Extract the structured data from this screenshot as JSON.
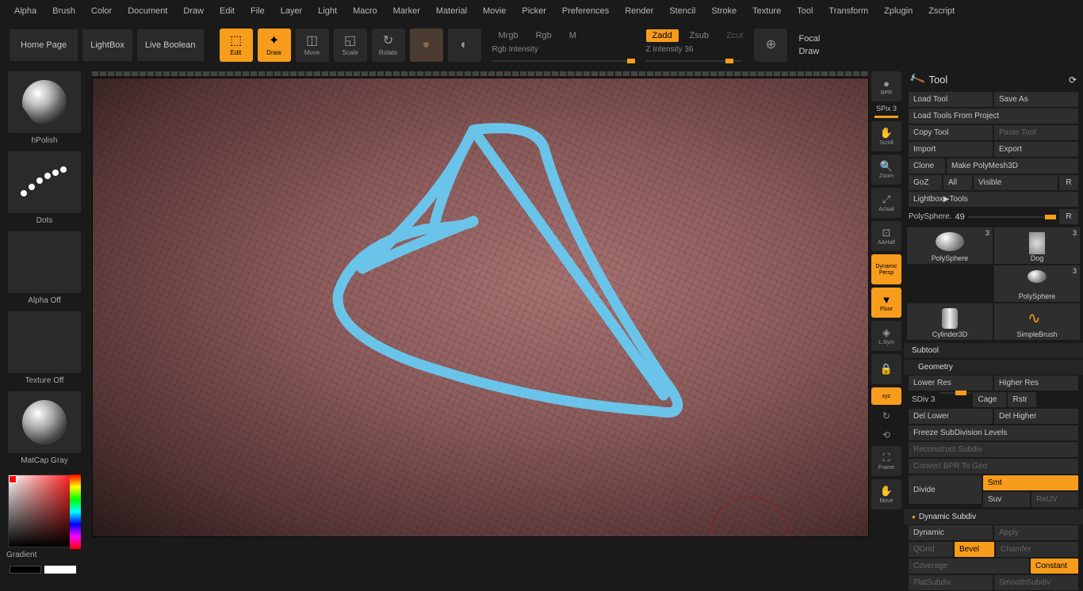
{
  "menu": [
    "Alpha",
    "Brush",
    "Color",
    "Document",
    "Draw",
    "Edit",
    "File",
    "Layer",
    "Light",
    "Macro",
    "Marker",
    "Material",
    "Movie",
    "Picker",
    "Preferences",
    "Render",
    "Stencil",
    "Stroke",
    "Texture",
    "Tool",
    "Transform",
    "Zplugin",
    "Zscript"
  ],
  "toolbar": {
    "home": "Home Page",
    "lightbox": "LightBox",
    "liveBoolean": "Live Boolean",
    "edit": "Edit",
    "draw": "Draw",
    "move": "Move",
    "scale": "Scale",
    "rotate": "Rotate",
    "mrgb": "Mrgb",
    "rgb": "Rgb",
    "m": "M",
    "rgbIntensity": "Rgb Intensity",
    "zadd": "Zadd",
    "zsub": "Zsub",
    "zcut": "Zcut",
    "zIntensity": "Z Intensity",
    "zIntensityVal": "36",
    "focal": "Focal",
    "drawSize": "Draw"
  },
  "leftPanel": {
    "brush": "hPolish",
    "stroke": "Dots",
    "alpha": "Alpha Off",
    "texture": "Texture Off",
    "material": "MatCap Gray",
    "gradient": "Gradient"
  },
  "rightTools": {
    "bpr": "BPR",
    "spix": "SPix",
    "spixVal": "3",
    "scroll": "Scroll",
    "zoom": "Zoom",
    "actual": "Actual",
    "aahalf": "AAHalf",
    "persp": "Persp",
    "floor": "Floor",
    "lsym": "L.Sym",
    "xyz": "xyz",
    "frame": "Frame",
    "moveNav": "Move"
  },
  "toolPanel": {
    "title": "Tool",
    "loadTool": "Load Tool",
    "saveAs": "Save As",
    "loadProject": "Load Tools From Project",
    "copyTool": "Copy Tool",
    "pasteTool": "Paste Tool",
    "import": "Import",
    "export": "Export",
    "clone": "Clone",
    "makePoly": "Make PolyMesh3D",
    "goz": "GoZ",
    "all": "All",
    "visible": "Visible",
    "r": "R",
    "lightboxTools": "Lightbox▶Tools",
    "polysphere": "PolySphere.",
    "polysphereVal": "49",
    "subtools": [
      {
        "name": "PolySphere",
        "count": "3"
      },
      {
        "name": "Dog",
        "count": "3"
      },
      {
        "name": "PolySphere",
        "count": "3"
      },
      {
        "name": "Cylinder3D",
        "count": ""
      },
      {
        "name": "SimpleBrush",
        "count": ""
      }
    ],
    "subtool": "Subtool",
    "geometry": "Geometry",
    "lowerRes": "Lower Res",
    "higherRes": "Higher Res",
    "sdiv": "SDiv",
    "sdivVal": "3",
    "cage": "Cage",
    "rstr": "Rstr",
    "delLower": "Del Lower",
    "delHigher": "Del Higher",
    "freeze": "Freeze SubDivision Levels",
    "reconstruct": "Reconstruct Subdiv",
    "convertBPR": "Convert BPR To Geo",
    "divide": "Divide",
    "smt": "Smt",
    "suv": "Suv",
    "reuv": "ReUV",
    "dynamicSubdiv": "Dynamic Subdiv",
    "dynamic": "Dynamic",
    "apply": "Apply",
    "qgrid": "QGrid",
    "bevel": "Bevel",
    "chamfer": "Chamfer",
    "coverage": "Coverage",
    "constant": "Constant",
    "flatSubdiv": "FlatSubdiv",
    "smoothSubdiv": "SmoothSubdiv"
  }
}
